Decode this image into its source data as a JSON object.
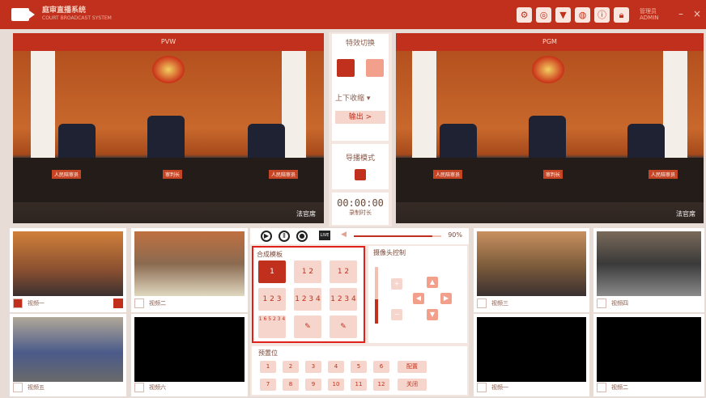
{
  "app": {
    "title": "庭审直播系统",
    "subtitle": "COURT BROADCAST SYSTEM"
  },
  "toolbar": {
    "icons": [
      "gear-icon",
      "target-icon",
      "shirt-icon",
      "globe-icon",
      "info-icon",
      "lock-icon"
    ],
    "user": "管理员",
    "user_sub": "ADMIN",
    "minimize": "–",
    "close": "×"
  },
  "pvw": {
    "title": "PVW",
    "label": "法官席"
  },
  "pgm": {
    "title": "PGM",
    "label": "法官席"
  },
  "nameplates": [
    "人民陪审员",
    "审判长",
    "人民陪审员"
  ],
  "special": {
    "title": "特效切换",
    "transition": "上下收缩",
    "output": "输出 >"
  },
  "director": {
    "title": "导播模式"
  },
  "timer": {
    "value": "00:00:00",
    "label": "录制时长"
  },
  "volume": {
    "value": "90%",
    "level": 0.9
  },
  "layout": {
    "title": "合成模板",
    "tiles": [
      "1",
      "1 2",
      "1 2",
      "1 2 3",
      "1 2 3 4",
      "1 2 3 4",
      "1 6 5 2 3 4",
      "",
      ""
    ]
  },
  "camera_ctrl": {
    "title": "摄像头控制"
  },
  "preset": {
    "title": "预置位",
    "row1": [
      "1",
      "2",
      "3",
      "4",
      "5",
      "6"
    ],
    "row2": [
      "7",
      "8",
      "9",
      "10",
      "11",
      "12"
    ],
    "config": "配置",
    "close": "关闭"
  },
  "cams": [
    {
      "name": "视频一",
      "checked": true
    },
    {
      "name": "视频二",
      "checked": false
    },
    {
      "name": "视频五",
      "checked": false
    },
    {
      "name": "视频六",
      "checked": false
    },
    {
      "name": "视频三",
      "checked": false
    },
    {
      "name": "视频四",
      "checked": false
    },
    {
      "name": "视频一",
      "checked": false
    },
    {
      "name": "视频二",
      "checked": false
    }
  ]
}
